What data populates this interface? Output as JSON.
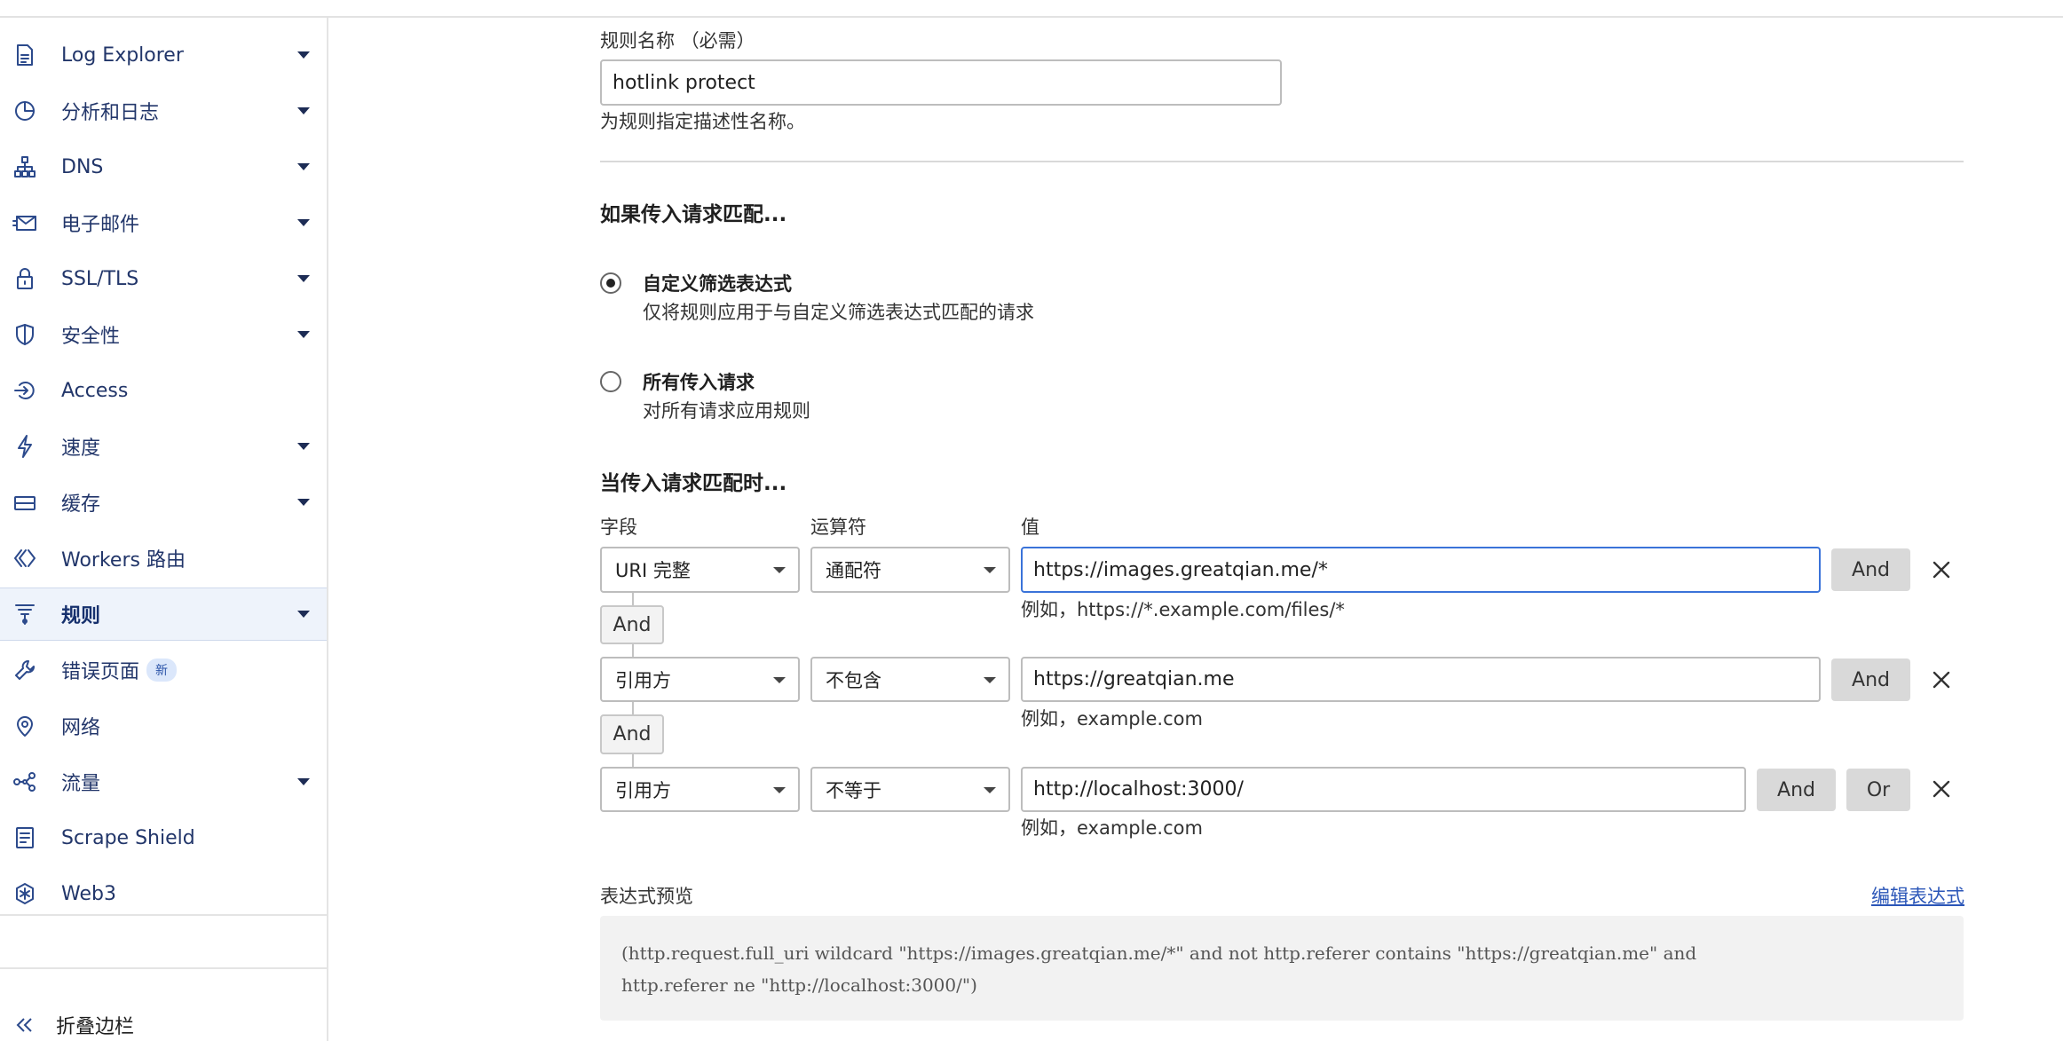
{
  "sidebar": {
    "items": [
      {
        "label": "Log Explorer",
        "icon": "log-explorer-icon",
        "caret": true
      },
      {
        "label": "分析和日志",
        "icon": "analytics-icon",
        "caret": true
      },
      {
        "label": "DNS",
        "icon": "dns-icon",
        "caret": true
      },
      {
        "label": "电子邮件",
        "icon": "email-icon",
        "caret": true
      },
      {
        "label": "SSL/TLS",
        "icon": "lock-icon",
        "caret": true
      },
      {
        "label": "安全性",
        "icon": "shield-icon",
        "caret": true
      },
      {
        "label": "Access",
        "icon": "access-icon",
        "caret": false
      },
      {
        "label": "速度",
        "icon": "lightning-icon",
        "caret": true
      },
      {
        "label": "缓存",
        "icon": "cache-icon",
        "caret": true
      },
      {
        "label": "Workers 路由",
        "icon": "workers-icon",
        "caret": false
      },
      {
        "label": "规则",
        "icon": "rules-icon",
        "caret": true,
        "active": true
      },
      {
        "label": "错误页面",
        "icon": "wrench-icon",
        "caret": false,
        "badge": "新"
      },
      {
        "label": "网络",
        "icon": "location-pin-icon",
        "caret": false
      },
      {
        "label": "流量",
        "icon": "traffic-icon",
        "caret": true
      },
      {
        "label": "Scrape Shield",
        "icon": "scrape-shield-icon",
        "caret": false
      },
      {
        "label": "Web3",
        "icon": "web3-icon",
        "caret": false
      }
    ],
    "collapse_label": "折叠边栏"
  },
  "rule_name": {
    "label": "规则名称 （必需）",
    "value": "hotlink protect",
    "help": "为规则指定描述性名称。"
  },
  "match_section": {
    "heading": "如果传入请求匹配...",
    "options": [
      {
        "title": "自定义筛选表达式",
        "desc": "仅将规则应用于与自定义筛选表达式匹配的请求",
        "checked": true
      },
      {
        "title": "所有传入请求",
        "desc": "对所有请求应用规则",
        "checked": false
      }
    ]
  },
  "conditions": {
    "heading": "当传入请求匹配时...",
    "col_field": "字段",
    "col_operator": "运算符",
    "col_value": "值",
    "rows": [
      {
        "field": "URI 完整",
        "operator": "通配符",
        "value": "https://images.greatqian.me/*",
        "hint": "例如，https://*.example.com/files/*",
        "and_label": "And"
      },
      {
        "field": "引用方",
        "operator": "不包含",
        "value": "https://greatqian.me",
        "hint": "例如，example.com",
        "and_label": "And"
      },
      {
        "field": "引用方",
        "operator": "不等于",
        "value": "http://localhost:3000/",
        "hint": "例如，example.com",
        "and_label": "And",
        "or_label": "Or"
      }
    ],
    "joiners": [
      "And",
      "And"
    ]
  },
  "preview": {
    "label": "表达式预览",
    "edit_link": "编辑表达式",
    "line1": "(http.request.full_uri wildcard \"https://images.greatqian.me/*\" and not http.referer contains \"https://greatqian.me\" and",
    "line2": "http.referer ne \"http://localhost:3000/\")"
  }
}
